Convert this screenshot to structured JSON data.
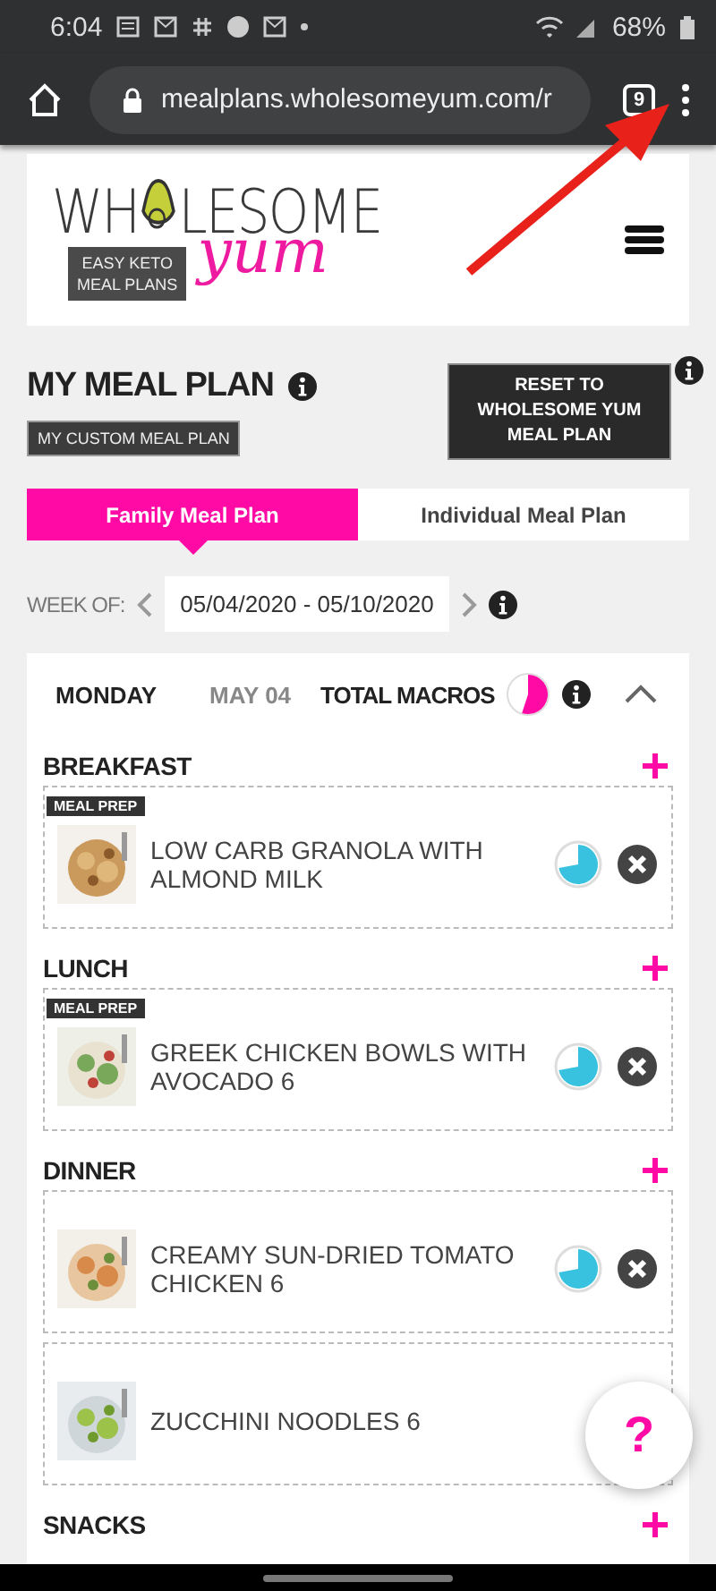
{
  "status_bar": {
    "time": "6:04",
    "battery": "68%"
  },
  "browser": {
    "url": "mealplans.wholesomeyum.com/r",
    "tab_count": "9"
  },
  "logo": {
    "word_left": "WH",
    "word_right": "LESOME",
    "script": "yum",
    "tagline_1": "EASY KETO",
    "tagline_2": "MEAL PLANS"
  },
  "plan": {
    "title": "MY MEAL PLAN",
    "badge": "MY CUSTOM MEAL PLAN",
    "reset_button": "RESET TO WHOLESOME YUM MEAL PLAN"
  },
  "tabs": [
    {
      "label": "Family Meal Plan",
      "selected": true
    },
    {
      "label": "Individual Meal Plan",
      "selected": false
    }
  ],
  "week": {
    "label": "WEEK OF:",
    "range": "05/04/2020 - 05/10/2020"
  },
  "day": {
    "name": "MONDAY",
    "date": "MAY 04",
    "macros_label": "TOTAL MACROS",
    "expanded": true,
    "meals": [
      {
        "title": "BREAKFAST",
        "items": [
          {
            "name": "LOW CARB GRANOLA WITH ALMOND MILK",
            "meal_prep": true,
            "tag": "MEAL PREP",
            "macros_shown": true
          }
        ]
      },
      {
        "title": "LUNCH",
        "items": [
          {
            "name": "GREEK CHICKEN BOWLS WITH AVOCADO 6",
            "meal_prep": true,
            "tag": "MEAL PREP",
            "macros_shown": true
          }
        ]
      },
      {
        "title": "DINNER",
        "items": [
          {
            "name": "CREAMY SUN-DRIED TOMATO CHICKEN 6",
            "meal_prep": false,
            "macros_shown": true
          },
          {
            "name": "ZUCCHINI NOODLES 6",
            "meal_prep": false,
            "macros_shown": false
          }
        ]
      },
      {
        "title": "SNACKS"
      }
    ]
  },
  "help_button": "?"
}
